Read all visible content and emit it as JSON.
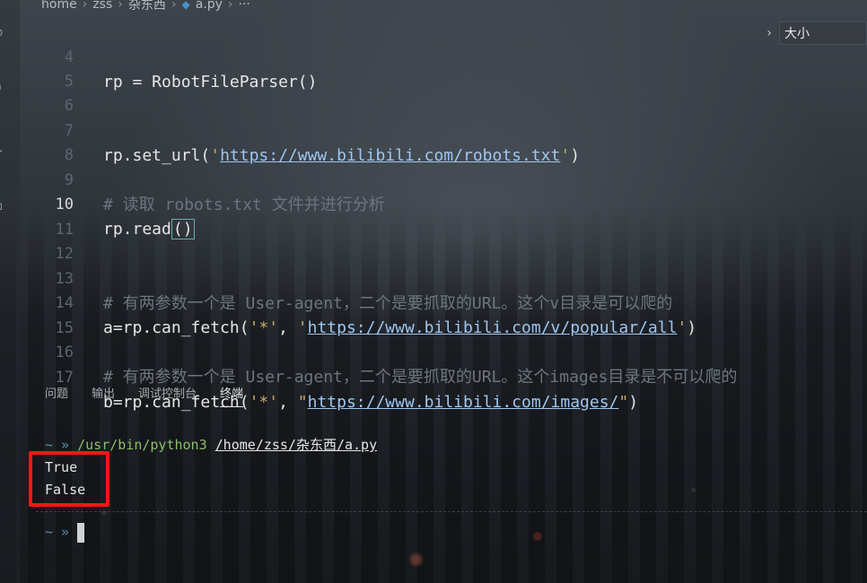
{
  "breadcrumb": [
    "home",
    "zss",
    "杂东西",
    "a.py",
    "···"
  ],
  "search": {
    "value": "大小"
  },
  "editor": {
    "lines": [
      {
        "n": "4",
        "kind": "code"
      },
      {
        "n": "5"
      },
      {
        "n": "6"
      },
      {
        "n": "7",
        "kind": "code"
      },
      {
        "n": "8"
      },
      {
        "n": "9",
        "kind": "comment"
      },
      {
        "n": "10",
        "kind": "code",
        "active": true
      },
      {
        "n": "11"
      },
      {
        "n": "12"
      },
      {
        "n": "13",
        "kind": "comment"
      },
      {
        "n": "14",
        "kind": "code"
      },
      {
        "n": "15"
      },
      {
        "n": "16",
        "kind": "comment"
      },
      {
        "n": "17",
        "kind": "code"
      }
    ],
    "code": {
      "l4": "rp = RobotFileParser()",
      "l7_pre": "rp.set_url(",
      "l7_url": "https://www.bilibili.com/robots.txt",
      "l7_post": ")",
      "l9": "# 读取 robots.txt 文件并进行分析",
      "l10_pre": "rp.read",
      "l10_box": "()",
      "l13": "# 有两参数一个是 User-agent，二个是要抓取的URL。这个v目录是可以爬的",
      "l14_pre": "a=rp.can_fetch(",
      "l14_star": "'*'",
      "l14_mid": ", ",
      "l14_url": "https://www.bilibili.com/v/popular/all",
      "l14_post": ")",
      "l16": "# 有两参数一个是 User-agent，二个是要抓取的URL。这个images目录是不可以爬的",
      "l17_pre": "b=rp.can_fetch(",
      "l17_star": "'*'",
      "l17_mid": ", ",
      "l17_url": "https://www.bilibili.com/images/",
      "l17_post": ")"
    }
  },
  "panel": {
    "tabs": [
      "问题",
      "输出",
      "调试控制台",
      "终端"
    ],
    "active_tab": "终端"
  },
  "terminal": {
    "prompt": "~ »",
    "command": "/usr/bin/python3",
    "argument": "/home/zss/杂东西/a.py",
    "output": [
      "True",
      "False"
    ]
  }
}
